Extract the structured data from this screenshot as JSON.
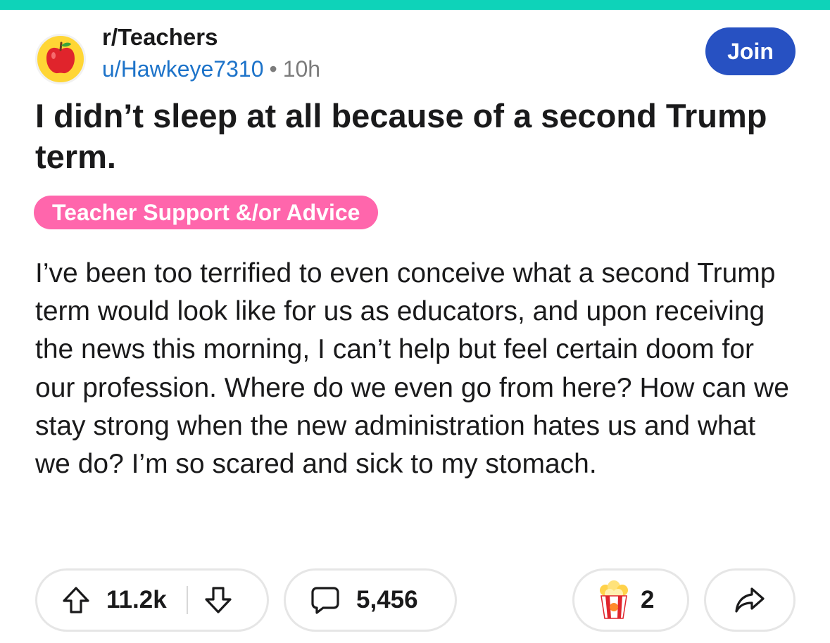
{
  "colors": {
    "top_bar": "#0ed3b9",
    "join_button": "#2751c2",
    "flair": "#ff66ac",
    "username": "#1d73c9"
  },
  "post": {
    "subreddit": "r/Teachers",
    "subreddit_icon": "apple-icon",
    "author": "u/Hawkeye7310",
    "separator": "•",
    "age": "10h",
    "join_label": "Join",
    "title": "I didn’t sleep at all because of a second Trump term.",
    "flair": "Teacher Support &/or Advice",
    "body": "I’ve been too terrified to even conceive what a second Trump term would look like for us as educators, and upon receiving the news this morning, I can’t help but feel certain doom for our profession. Where do we even go from here? How can we stay strong when the new administration hates us and what we do? I’m so scared and sick to my stomach."
  },
  "actions": {
    "upvote_icon": "upvote-arrow-icon",
    "vote_count": "11.2k",
    "downvote_icon": "downvote-arrow-icon",
    "comment_icon": "comment-bubble-icon",
    "comment_count": "5,456",
    "award_icon": "popcorn-award-icon",
    "award_count": "2",
    "share_icon": "share-arrow-icon"
  }
}
